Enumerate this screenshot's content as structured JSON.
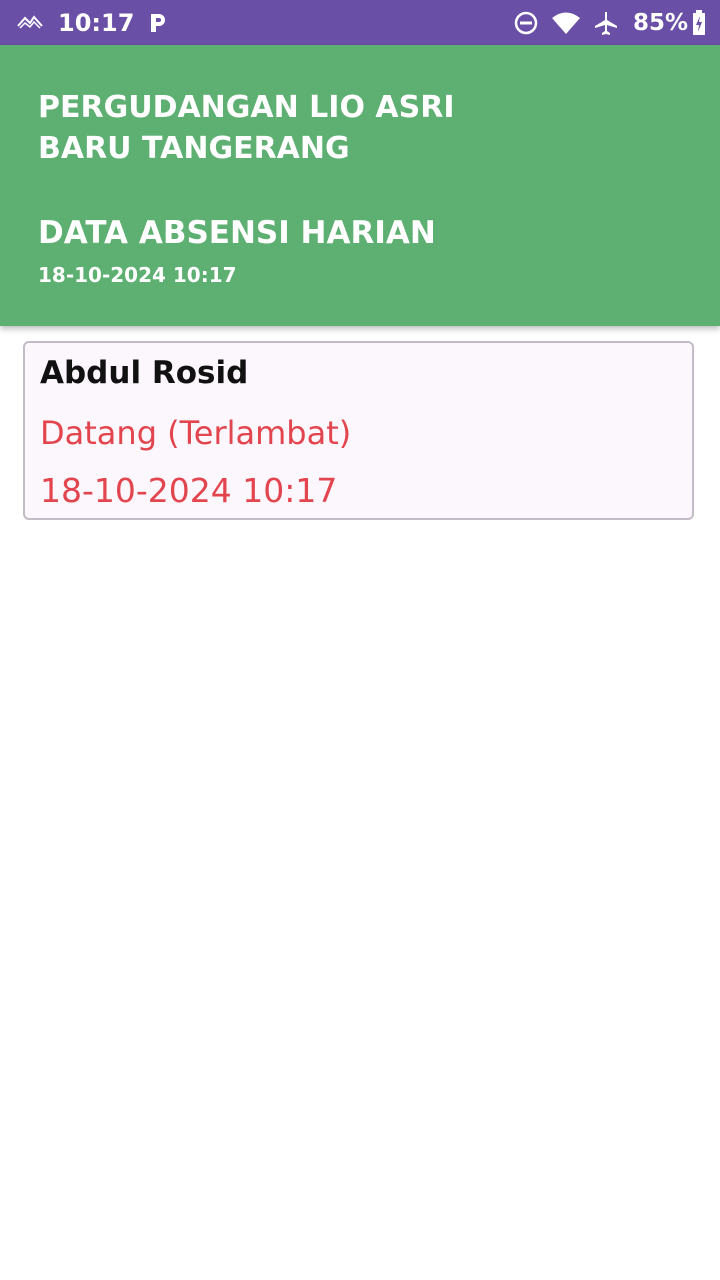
{
  "status_bar": {
    "time": "10:17",
    "battery": "85%",
    "icons": [
      "signal-icon",
      "parking-icon",
      "do-not-disturb-icon",
      "wifi-icon",
      "airplane-icon",
      "battery-icon"
    ]
  },
  "header": {
    "company": "PERGUDANGAN LIO ASRI\nBARU TANGERANG",
    "title": "DATA ABSENSI HARIAN",
    "datetime": "18-10-2024 10:17",
    "background_color": "#5daf72"
  },
  "attendance": [
    {
      "name": "Abdul Rosid",
      "status": "Datang (Terlambat)",
      "datetime": "18-10-2024 10:17",
      "status_color": "#e2454e"
    }
  ]
}
